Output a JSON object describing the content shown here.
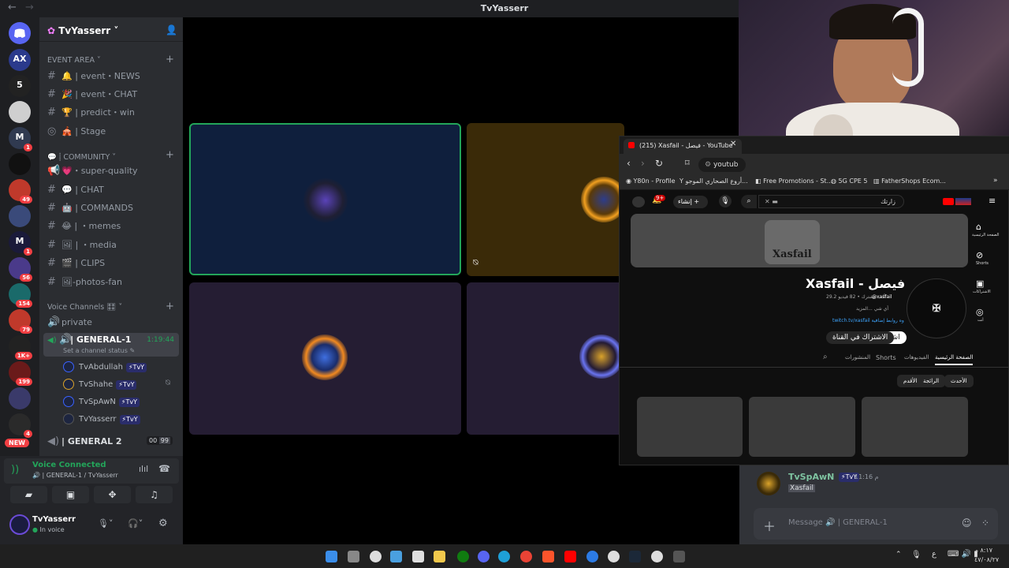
{
  "window": {
    "title": "TvYasserr",
    "back": "←",
    "forward": "→"
  },
  "server": {
    "name": "TvYasserr ˅"
  },
  "servers": [
    {
      "label": "AX",
      "badge": ""
    },
    {
      "label": "5",
      "badge": ""
    },
    {
      "label": "",
      "badge": ""
    },
    {
      "label": "M",
      "badge": "1"
    },
    {
      "label": "",
      "badge": ""
    },
    {
      "label": "",
      "badge": "49"
    },
    {
      "label": "",
      "badge": ""
    },
    {
      "label": "M",
      "badge": "1"
    },
    {
      "label": "",
      "badge": "56"
    },
    {
      "label": "",
      "badge": "154"
    },
    {
      "label": "",
      "badge": "79"
    },
    {
      "label": "",
      "badge": "1K+"
    },
    {
      "label": "",
      "badge": "199"
    },
    {
      "label": "",
      "badge": ""
    },
    {
      "label": "",
      "badge": "4"
    }
  ],
  "new_label": "NEW",
  "categories": {
    "event_area": "EVENT AREA ˅",
    "community": "COMMUNITY ˅",
    "voice": "Voice Channels 🎛 ˅"
  },
  "channels": [
    {
      "name": "🔔 | event・NEWS"
    },
    {
      "name": "🎉 | event・CHAT"
    },
    {
      "name": "🏆 | predict・win"
    },
    {
      "name": "🎪 | Stage"
    },
    {
      "name": "💗・super-quality"
    },
    {
      "name": "💬 | CHAT"
    },
    {
      "name": "🤖 | COMMANDS"
    },
    {
      "name": "😂 | ・memes"
    },
    {
      "name": "🖼 | ・media"
    },
    {
      "name": "🎬 | CLIPS"
    },
    {
      "name": "🖼-photos-fan"
    }
  ],
  "voice": {
    "private": "private",
    "general1": "| GENERAL-1",
    "general1_time": "1:19:44",
    "status_hint": "Set a channel status ✎",
    "general2": "| GENERAL 2",
    "general2_count": "00",
    "general2_limit": "99",
    "users": [
      {
        "name": "TvAbdullah",
        "tag": "⚡TvY"
      },
      {
        "name": "TvShahe",
        "tag": "⚡TvY"
      },
      {
        "name": "TvSpAwN",
        "tag": "⚡TvY"
      },
      {
        "name": "TvYasserr",
        "tag": "⚡TvY"
      }
    ]
  },
  "voice_connected": {
    "title": "Voice Connected",
    "channel": "🔊 | GENERAL-1 / TvYasserr"
  },
  "user": {
    "name": "TvYasserr",
    "status": "In voice"
  },
  "browser": {
    "tab_title": "(215) Xasfail - فيصل - YouTube",
    "address": "youtub",
    "bookmarks": [
      "Y80n - Profile",
      "أروع الصحاري الموجو...",
      "Free Promotions - St...",
      "5G CPE 5",
      "FatherShops Ecom..."
    ],
    "search_placeholder": "زارتك",
    "create_label": "إنشاء",
    "notif_count": "9+",
    "channel_name": "Xasfail - فيصل",
    "handle": "@xasfail",
    "stats": "29.2 ألف مشترك • 82 فيديو",
    "about": "أي شي ...المزيد",
    "link": "twitch.tv/xasfail وه روابط إضافية",
    "subscribe": "اشتراك",
    "join": "الاشتراك في القناة",
    "tabs": [
      "الصفحة الرئيسية",
      "الفيديوهات",
      "Shorts",
      "المنشورات"
    ],
    "chips": [
      "الأحدث",
      "الرائجة",
      "الأقدم"
    ],
    "side_nav": [
      "الصفحة الرئيسية",
      "Shorts",
      "الاشتراكات",
      "أنت"
    ],
    "banner_text": "Xasfail"
  },
  "chat": {
    "author": "TvSpAwN",
    "tag": "⚡TvY",
    "time": "11:16 م",
    "message": "Xasfail",
    "input_placeholder": "Message 🔊 | GENERAL-1"
  },
  "taskbar": {
    "lang": "ع",
    "time": "٨:١٧ م",
    "date": "٤٧/٠٨/٢٧"
  },
  "colors": {
    "accent": "#23a55a",
    "danger": "#f23f43",
    "blurple": "#5865f2"
  }
}
